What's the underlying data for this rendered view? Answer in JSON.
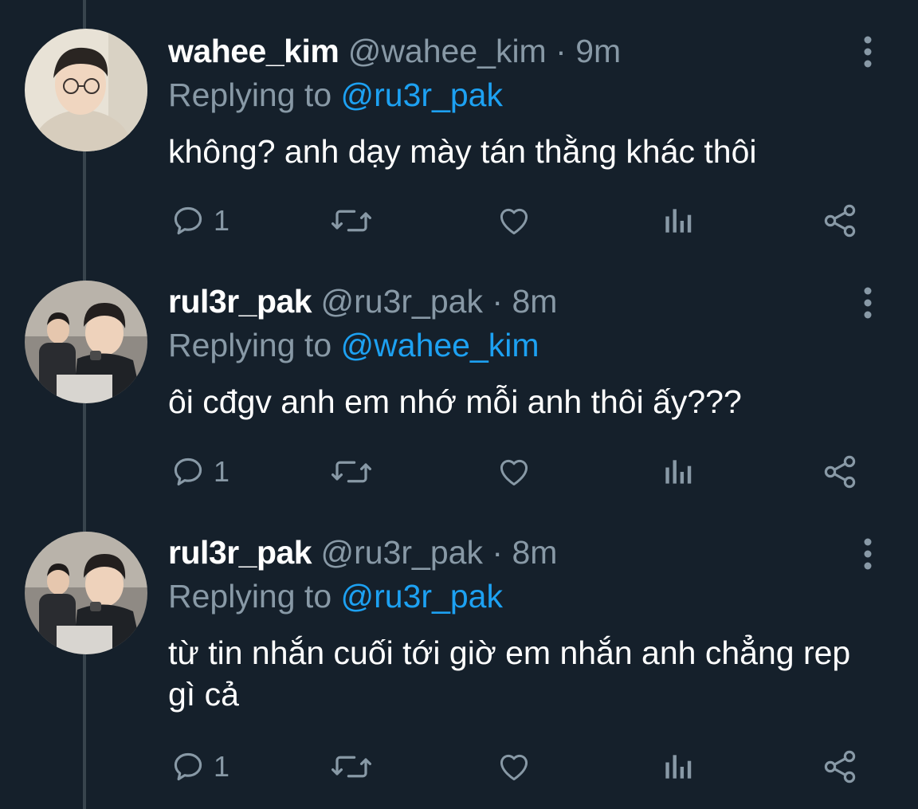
{
  "tweets": [
    {
      "name": "wahee_kim",
      "handle": "@wahee_kim",
      "separator": "·",
      "time": "9m",
      "replying_prefix": "Replying to",
      "replying_to": "@ru3r_pak",
      "text": "không? anh dạy mày tán thằng khác thôi",
      "reply_count": "1",
      "avatar": "avatar-wahee-kim"
    },
    {
      "name": "rul3r_pak",
      "handle": "@ru3r_pak",
      "separator": "·",
      "time": "8m",
      "replying_prefix": "Replying to",
      "replying_to": "@wahee_kim",
      "text": "ôi cđgv anh em nhớ mỗi anh thôi ấy???",
      "reply_count": "1",
      "avatar": "avatar-rul3r-pak"
    },
    {
      "name": "rul3r_pak",
      "handle": "@ru3r_pak",
      "separator": "·",
      "time": "8m",
      "replying_prefix": "Replying to",
      "replying_to": "@ru3r_pak",
      "text": "từ tin nhắn cuối tới giờ em nhắn anh chẳng rep gì cả",
      "reply_count": "1",
      "avatar": "avatar-rul3r-pak"
    }
  ],
  "icons": {
    "reply": "reply-icon",
    "retweet": "retweet-icon",
    "like": "heart-icon",
    "stats": "stats-icon",
    "share": "share-icon",
    "more": "more-vertical-icon"
  },
  "colors": {
    "background": "#15202b",
    "text": "#ffffff",
    "muted": "#8899a6",
    "link": "#1da1f2",
    "thread_line": "#38444d"
  }
}
